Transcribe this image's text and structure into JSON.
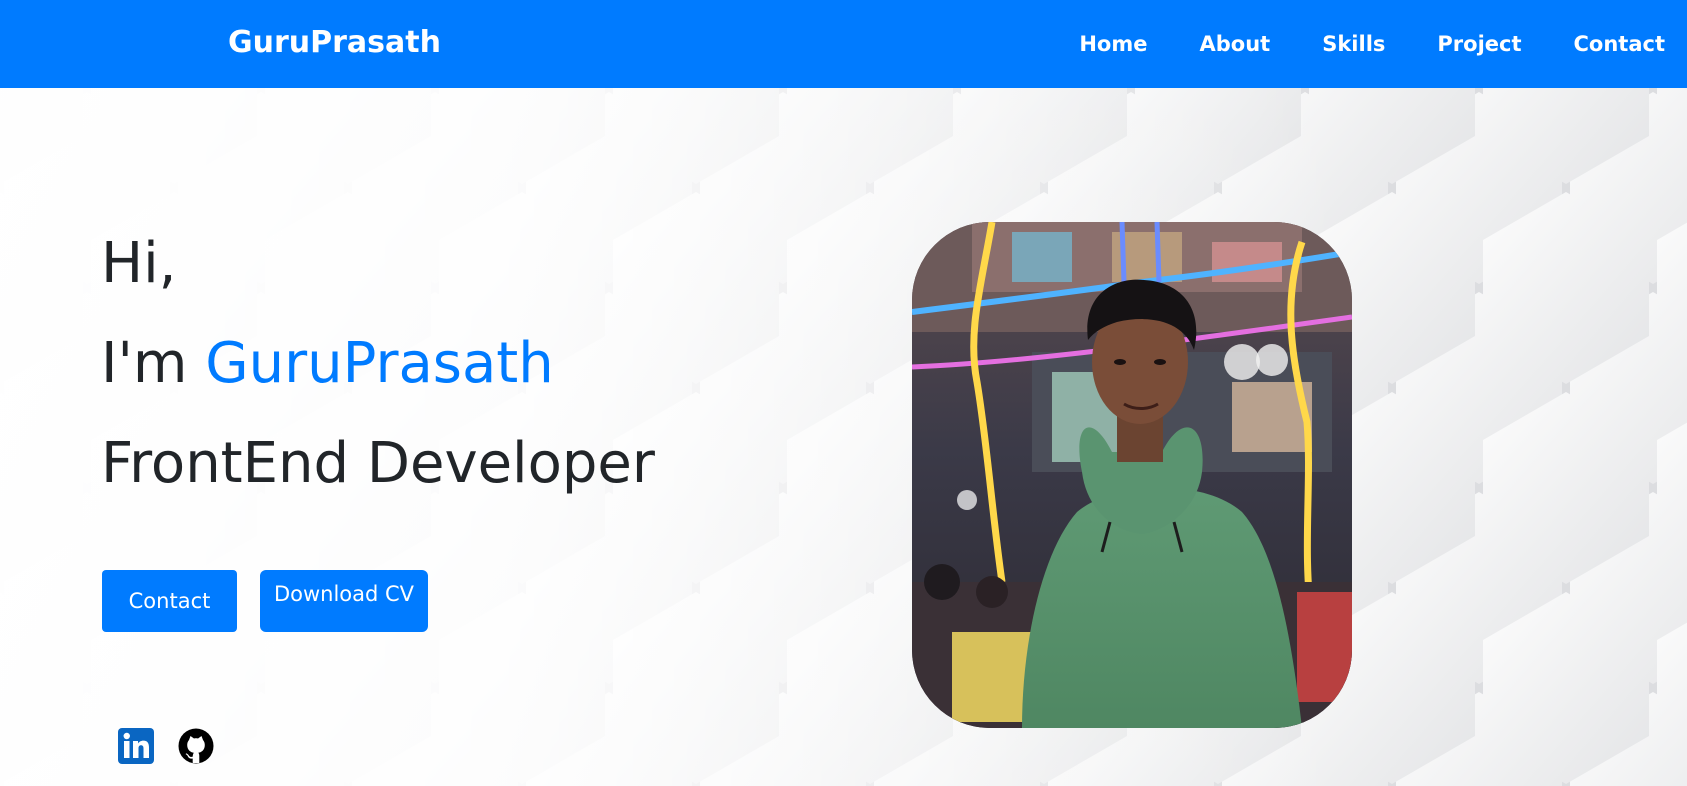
{
  "navbar": {
    "brand": "GuruPrasath",
    "links": [
      {
        "label": "Home"
      },
      {
        "label": "About"
      },
      {
        "label": "Skills"
      },
      {
        "label": "Project"
      },
      {
        "label": "Contact"
      }
    ]
  },
  "hero": {
    "greeting": "Hi,",
    "intro_prefix": "I'm ",
    "name": "GuruPrasath",
    "role": "FrontEnd Developer"
  },
  "buttons": {
    "contact_label": "Contact",
    "download_cv_label": "Download CV"
  },
  "social": {
    "linkedin_icon": "linkedin-icon",
    "github_icon": "github-icon"
  },
  "colors": {
    "accent": "#007bff",
    "text": "#212529",
    "linkedin": "#0a66c2"
  }
}
